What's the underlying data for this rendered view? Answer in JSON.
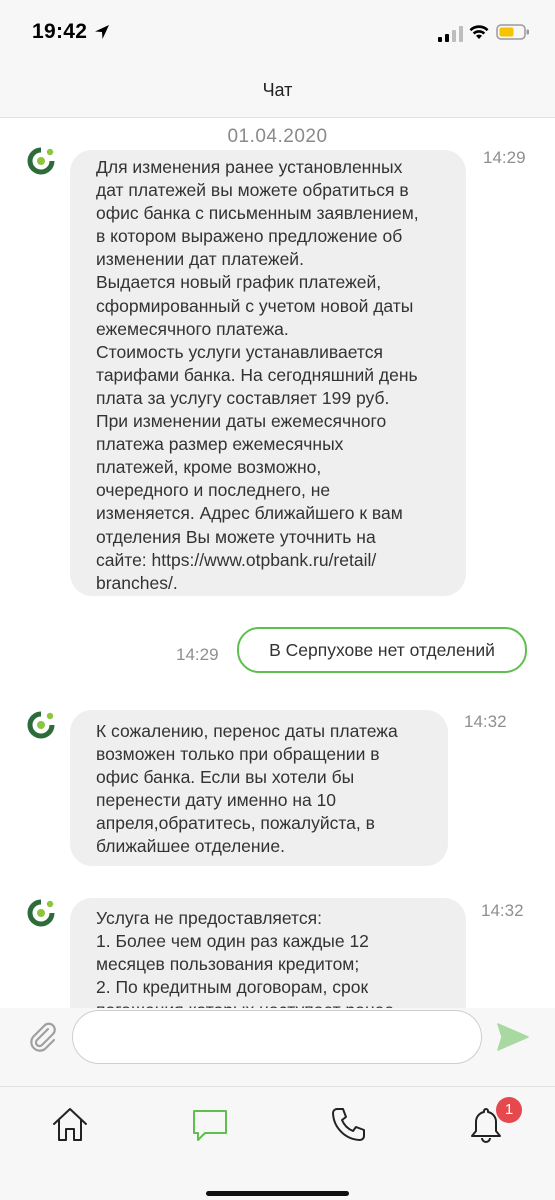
{
  "status_bar": {
    "time": "19:42",
    "icons": [
      "location-arrow-icon",
      "signal-icon",
      "wifi-icon",
      "battery-icon"
    ]
  },
  "header": {
    "title": "Чат"
  },
  "chat": {
    "date_separator": "01.04.2020",
    "messages": [
      {
        "direction": "incoming",
        "time": "14:29",
        "lines": [
          "Для изменения ранее установленных",
          "дат платежей вы можете обратиться в",
          "офис банка с письменным заявлением,",
          "в котором выражено предложение об",
          "изменении дат платежей.",
          "Выдается новый график платежей,",
          "сформированный с учетом новой даты",
          "ежемесячного платежа.",
          "Стоимость услуги устанавливается",
          "тарифами банка. На сегодняшний день",
          "плата за услугу составляет 199 руб.",
          "При изменении даты ежемесячного",
          "платежа размер ежемесячных",
          "платежей, кроме возможно,",
          "очередного и последнего, не",
          "изменяется. Адрес ближайшего к вам",
          "отделения Вы можете уточнить на",
          "сайте: https://www.otpbank.ru/retail/",
          "branches/."
        ]
      },
      {
        "direction": "outgoing",
        "time": "14:29",
        "text": "В Серпухове нет отделений"
      },
      {
        "direction": "incoming",
        "time": "14:32",
        "lines": [
          "К сожалению, перенос даты платежа",
          "возможен только при обращении в",
          "офис банка. Если вы хотели бы",
          "перенести дату именно на 10",
          "апреля,обратитесь, пожалуйста, в",
          "ближайшее отделение."
        ]
      },
      {
        "direction": "incoming",
        "time": "14:32",
        "lines": [
          "Услуга не предоставляется:",
          "1. Более чем один раз каждые 12",
          "месяцев пользования кредитом;",
          "2. По кредитным договорам, срок",
          "погашения которых наступает ранее"
        ]
      }
    ]
  },
  "input": {
    "value": "",
    "placeholder": "",
    "icons": [
      "paperclip-icon",
      "send-icon"
    ]
  },
  "tabbar": {
    "tabs": [
      {
        "name": "home",
        "icon": "home-icon",
        "active": false
      },
      {
        "name": "chat",
        "icon": "chat-bubble-icon",
        "active": true
      },
      {
        "name": "call",
        "icon": "phone-icon",
        "active": false
      },
      {
        "name": "notifications",
        "icon": "bell-icon",
        "active": false
      }
    ],
    "notification_badge": "1"
  },
  "colors": {
    "accent_green": "#5fbf4e",
    "brand_dark_green": "#2e6b3a",
    "incoming_bubble": "#efefef",
    "badge_red": "#e5484d"
  }
}
